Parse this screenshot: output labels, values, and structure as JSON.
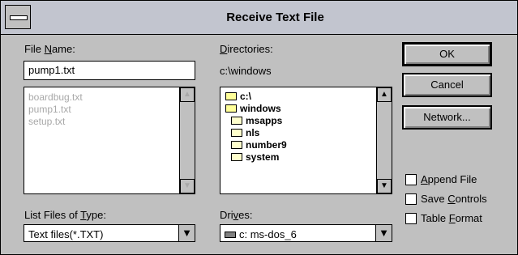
{
  "window": {
    "title": "Receive Text File"
  },
  "file_name": {
    "label_pre": "File ",
    "label_acc": "N",
    "label_post": "ame:",
    "value": "pump1.txt",
    "files": [
      "boardbug.txt",
      "pump1.txt",
      "setup.txt"
    ]
  },
  "directories": {
    "label_pre": "",
    "label_acc": "D",
    "label_post": "irectories:",
    "current_path": "c:\\windows",
    "tree": [
      {
        "name": "c:\\",
        "type": "open"
      },
      {
        "name": "windows",
        "type": "open"
      },
      {
        "name": "msapps",
        "type": "closed"
      },
      {
        "name": "nls",
        "type": "closed"
      },
      {
        "name": "number9",
        "type": "closed"
      },
      {
        "name": "system",
        "type": "closed"
      }
    ]
  },
  "file_types": {
    "label_pre": "List Files of ",
    "label_acc": "T",
    "label_post": "ype:",
    "value": "Text files(*.TXT)"
  },
  "drives": {
    "label_pre": "Dri",
    "label_acc": "v",
    "label_post": "es:",
    "value": "c: ms-dos_6"
  },
  "buttons": {
    "ok": "OK",
    "cancel": "Cancel",
    "network": "Network..."
  },
  "options": {
    "append_pre": "",
    "append_acc": "A",
    "append_post": "ppend File",
    "save_pre": "Save ",
    "save_acc": "C",
    "save_post": "ontrols",
    "table_pre": "Table ",
    "table_acc": "F",
    "table_post": "ormat"
  }
}
